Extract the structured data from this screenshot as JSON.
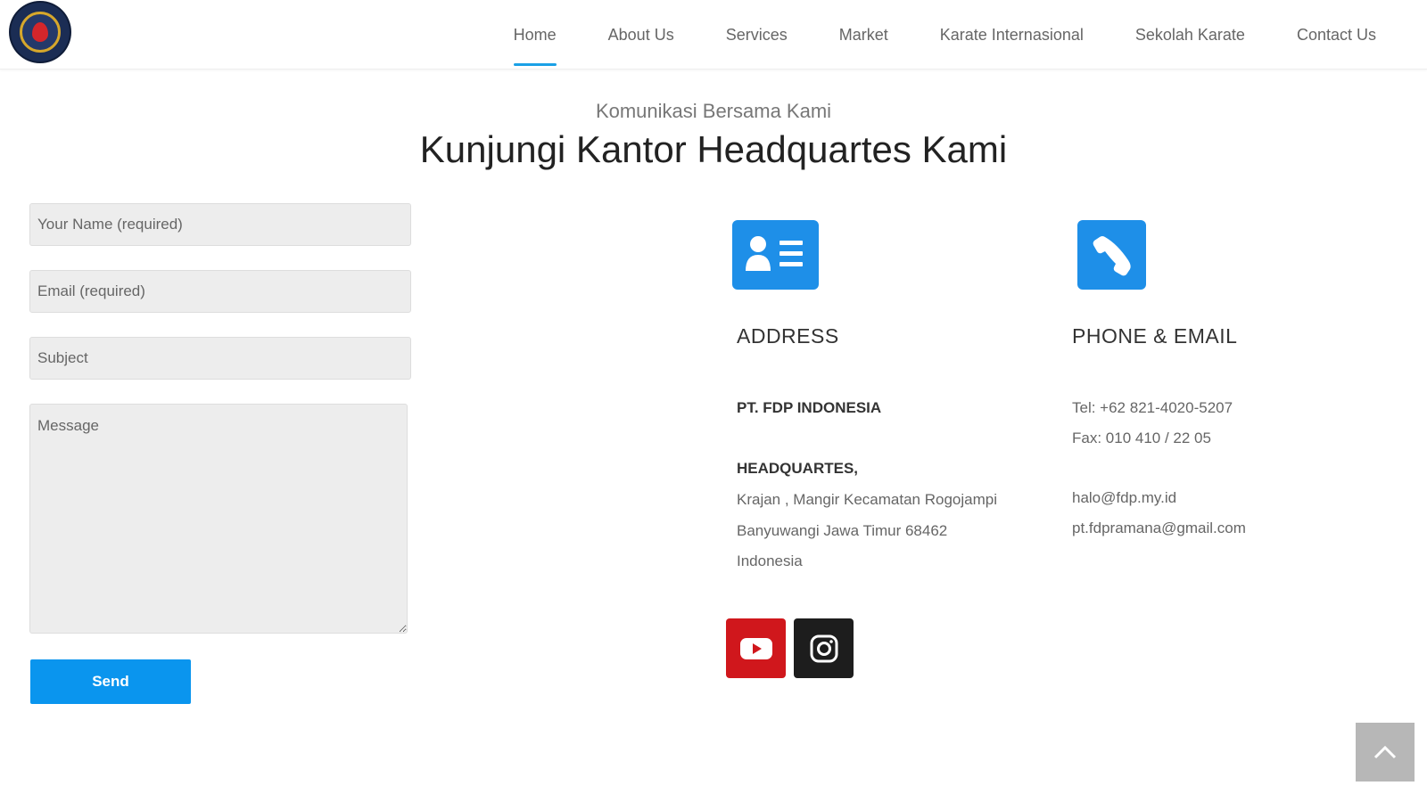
{
  "header": {
    "nav": [
      {
        "label": "Home",
        "active": true
      },
      {
        "label": "About Us"
      },
      {
        "label": "Services"
      },
      {
        "label": "Market"
      },
      {
        "label": "Karate Internasional"
      },
      {
        "label": "Sekolah Karate"
      },
      {
        "label": "Contact Us"
      }
    ]
  },
  "section": {
    "subtitle": "Komunikasi Bersama Kami",
    "title": "Kunjungi Kantor Headquartes Kami"
  },
  "form": {
    "name_placeholder": "Your Name (required)",
    "email_placeholder": "Email (required)",
    "subject_placeholder": "Subject",
    "message_placeholder": "Message",
    "send_label": "Send"
  },
  "address": {
    "icon": "address-card-icon",
    "heading": "ADDRESS",
    "company": "PT. FDP INDONESIA",
    "hq": "HEADQUARTES,",
    "line1": "Krajan , Mangir Kecamatan Rogojampi",
    "line2": "Banyuwangi Jawa Timur 68462",
    "line3": "Indonesia"
  },
  "contact": {
    "icon": "phone-icon",
    "heading": "PHONE & EMAIL",
    "tel": "Tel: +62 821-4020-5207",
    "fax": "Fax: 010 410 / 22 05",
    "email1": "halo@fdp.my.id",
    "email2": "pt.fdpramana@gmail.com"
  },
  "social": [
    {
      "name": "youtube-icon",
      "color": "#d0171c"
    },
    {
      "name": "instagram-icon",
      "color": "#1d1d1d"
    }
  ],
  "colors": {
    "accent": "#1aa0e6",
    "button": "#0a95ee",
    "icon_box": "#1e8fe8"
  }
}
